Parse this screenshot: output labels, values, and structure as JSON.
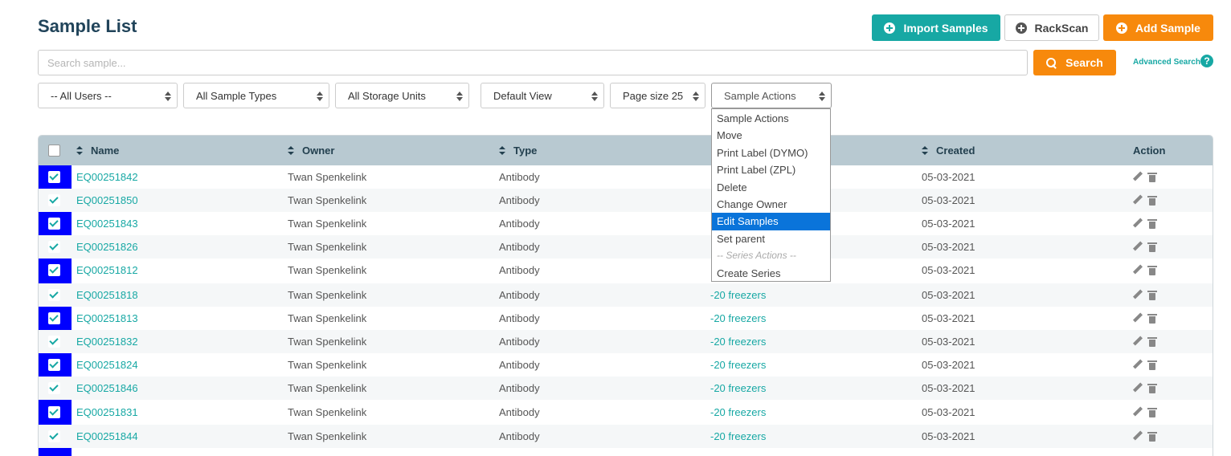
{
  "header": {
    "title": "Sample List",
    "import_label": "Import Samples",
    "rackscan_label": "RackScan",
    "add_label": "Add Sample"
  },
  "search": {
    "placeholder": "Search sample...",
    "button_label": "Search",
    "advanced_label": "Advanced Search",
    "help_label": "?"
  },
  "filters": {
    "users": "-- All Users --",
    "types": "All Sample Types",
    "storage": "All Storage Units",
    "view": "Default View",
    "page_size": "Page size 25",
    "actions": "Sample Actions"
  },
  "actions_menu": {
    "items": [
      "Sample Actions",
      "Move",
      "Print Label (DYMO)",
      "Print Label (ZPL)",
      "Delete",
      "Change Owner",
      "Edit Samples",
      "Set parent",
      "-- Series Actions --",
      "Create Series"
    ],
    "highlighted": "Edit Samples"
  },
  "table": {
    "columns": {
      "name": "Name",
      "owner": "Owner",
      "type": "Type",
      "created": "Created",
      "action": "Action"
    },
    "rows": [
      {
        "name": "EQ00251842",
        "owner": "Twan Spenkelink",
        "type": "Antibody",
        "storage": "",
        "created": "05-03-2021"
      },
      {
        "name": "EQ00251850",
        "owner": "Twan Spenkelink",
        "type": "Antibody",
        "storage": "",
        "created": "05-03-2021"
      },
      {
        "name": "EQ00251843",
        "owner": "Twan Spenkelink",
        "type": "Antibody",
        "storage": "",
        "created": "05-03-2021"
      },
      {
        "name": "EQ00251826",
        "owner": "Twan Spenkelink",
        "type": "Antibody",
        "storage": "",
        "created": "05-03-2021"
      },
      {
        "name": "EQ00251812",
        "owner": "Twan Spenkelink",
        "type": "Antibody",
        "storage": "",
        "created": "05-03-2021"
      },
      {
        "name": "EQ00251818",
        "owner": "Twan Spenkelink",
        "type": "Antibody",
        "storage": "-20 freezers",
        "created": "05-03-2021"
      },
      {
        "name": "EQ00251813",
        "owner": "Twan Spenkelink",
        "type": "Antibody",
        "storage": "-20 freezers",
        "created": "05-03-2021"
      },
      {
        "name": "EQ00251832",
        "owner": "Twan Spenkelink",
        "type": "Antibody",
        "storage": "-20 freezers",
        "created": "05-03-2021"
      },
      {
        "name": "EQ00251824",
        "owner": "Twan Spenkelink",
        "type": "Antibody",
        "storage": "-20 freezers",
        "created": "05-03-2021"
      },
      {
        "name": "EQ00251846",
        "owner": "Twan Spenkelink",
        "type": "Antibody",
        "storage": "-20 freezers",
        "created": "05-03-2021"
      },
      {
        "name": "EQ00251831",
        "owner": "Twan Spenkelink",
        "type": "Antibody",
        "storage": "-20 freezers",
        "created": "05-03-2021"
      },
      {
        "name": "EQ00251844",
        "owner": "Twan Spenkelink",
        "type": "Antibody",
        "storage": "-20 freezers",
        "created": "05-03-2021"
      }
    ]
  },
  "colors": {
    "teal": "#17a8a4",
    "orange": "#f7890c",
    "title": "#21445a",
    "table_header": "#b8c9d1",
    "selection_column": "#0000ff",
    "menu_highlight": "#0a74da"
  },
  "icons": {
    "import": "plus-circle-icon",
    "rackscan": "plus-circle-icon",
    "add": "plus-circle-icon",
    "search": "search-icon",
    "help": "question-circle-icon",
    "sort": "sort-icon",
    "edit": "pencil-icon",
    "delete": "trash-icon",
    "checkbox": "checkbox-checked-icon"
  }
}
